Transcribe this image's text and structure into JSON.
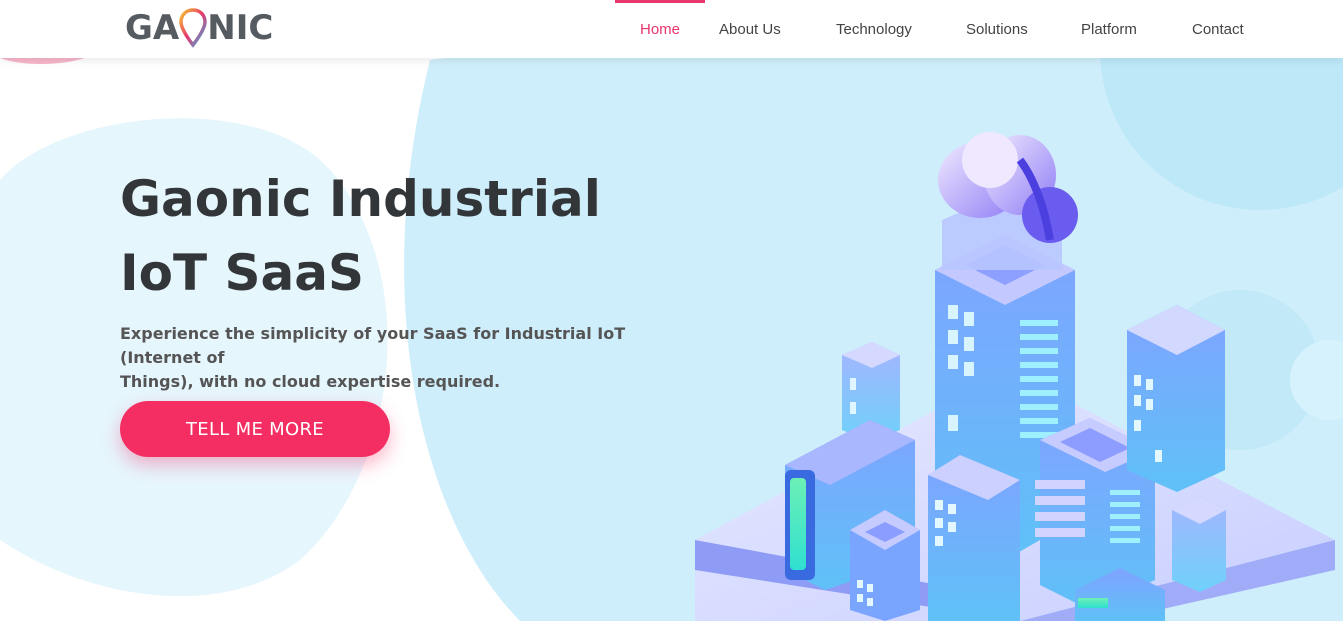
{
  "brand": {
    "logo_left": "GA",
    "logo_right": "NIC",
    "accent_color": "#e8356b",
    "text_color": "#555b60"
  },
  "nav": {
    "items": [
      {
        "label": "Home",
        "active": true
      },
      {
        "label": "About Us",
        "active": false
      },
      {
        "label": "Technology",
        "active": false
      },
      {
        "label": "Solutions",
        "active": false
      },
      {
        "label": "Platform",
        "active": false
      },
      {
        "label": "Contact",
        "active": false
      }
    ]
  },
  "hero": {
    "title_line1": "Gaonic Industrial",
    "title_line2": "IoT SaaS",
    "subtitle_line1": "Experience the simplicity of your SaaS for Industrial IoT (Internet of",
    "subtitle_line2": "Things), with no cloud expertise required.",
    "cta_label": "TELL ME MORE",
    "cta_color": "#f42e63"
  },
  "icons": {
    "logo_pin": "location-pin-icon",
    "illustration": "isometric-smart-city-illustration"
  }
}
